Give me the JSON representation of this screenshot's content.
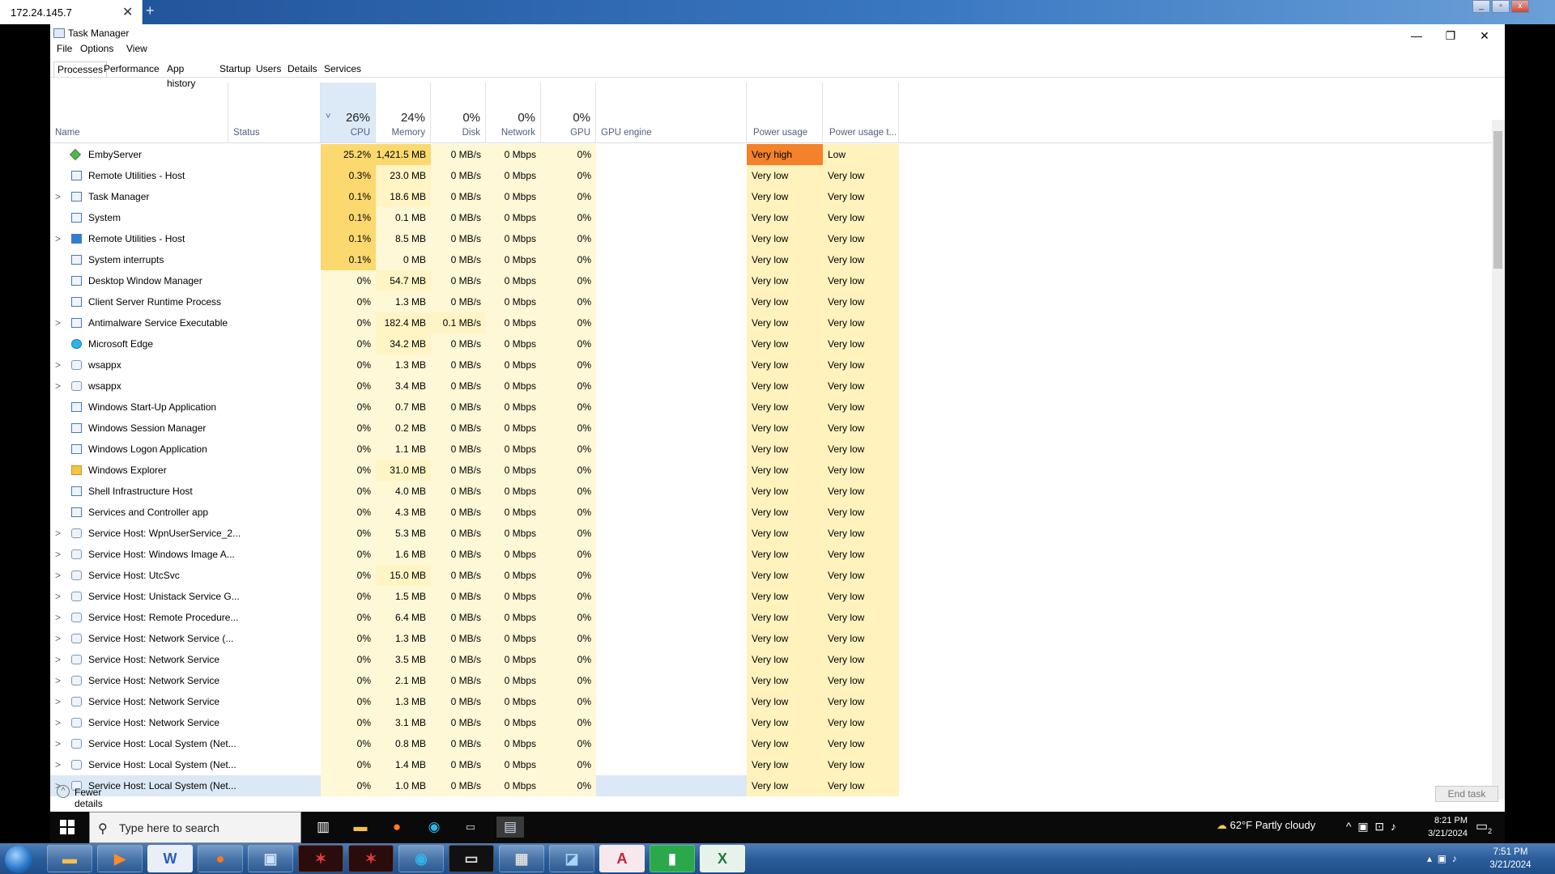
{
  "remote_tab": {
    "title": "172.24.145.7",
    "close": "✕",
    "new": "+"
  },
  "window": {
    "title": "Task Manager",
    "minimize": "—",
    "restore": "❐",
    "close": "✕"
  },
  "menu": [
    "File",
    "Options",
    "View"
  ],
  "tabs": [
    "Processes",
    "Performance",
    "App history",
    "Startup",
    "Users",
    "Details",
    "Services"
  ],
  "active_tab": "Processes",
  "columns": {
    "name": "Name",
    "status": "Status",
    "cpu_pct": "26%",
    "cpu": "CPU",
    "mem_pct": "24%",
    "memory": "Memory",
    "disk_pct": "0%",
    "disk": "Disk",
    "net_pct": "0%",
    "network": "Network",
    "gpu_pct": "0%",
    "gpu": "GPU",
    "gpu_engine": "GPU engine",
    "power": "Power usage",
    "power_trend": "Power usage t...",
    "sort_indicator": "˅"
  },
  "processes": [
    {
      "expand": "",
      "name": "EmbyServer",
      "cpu": "25.2%",
      "mem": "1,421.5 MB",
      "disk": "0 MB/s",
      "net": "0 Mbps",
      "gpu": "0%",
      "power": "Very high",
      "trend": "Low",
      "icon": "emby-icon"
    },
    {
      "expand": "",
      "name": "Remote Utilities - Host",
      "cpu": "0.3%",
      "mem": "23.0 MB",
      "disk": "0 MB/s",
      "net": "0 Mbps",
      "gpu": "0%",
      "power": "Very low",
      "trend": "Very low",
      "icon": "app-icon"
    },
    {
      "expand": ">",
      "name": "Task Manager",
      "cpu": "0.1%",
      "mem": "18.6 MB",
      "disk": "0 MB/s",
      "net": "0 Mbps",
      "gpu": "0%",
      "power": "Very low",
      "trend": "Very low",
      "icon": "task-manager-icon"
    },
    {
      "expand": "",
      "name": "System",
      "cpu": "0.1%",
      "mem": "0.1 MB",
      "disk": "0 MB/s",
      "net": "0 Mbps",
      "gpu": "0%",
      "power": "Very low",
      "trend": "Very low",
      "icon": "app-icon"
    },
    {
      "expand": ">",
      "name": "Remote Utilities - Host",
      "cpu": "0.1%",
      "mem": "8.5 MB",
      "disk": "0 MB/s",
      "net": "0 Mbps",
      "gpu": "0%",
      "power": "Very low",
      "trend": "Very low",
      "icon": "remote-utilities-icon"
    },
    {
      "expand": "",
      "name": "System interrupts",
      "cpu": "0.1%",
      "mem": "0 MB",
      "disk": "0 MB/s",
      "net": "0 Mbps",
      "gpu": "0%",
      "power": "Very low",
      "trend": "Very low",
      "icon": "app-icon"
    },
    {
      "expand": "",
      "name": "Desktop Window Manager",
      "cpu": "0%",
      "mem": "54.7 MB",
      "disk": "0 MB/s",
      "net": "0 Mbps",
      "gpu": "0%",
      "power": "Very low",
      "trend": "Very low",
      "icon": "app-icon"
    },
    {
      "expand": "",
      "name": "Client Server Runtime Process",
      "cpu": "0%",
      "mem": "1.3 MB",
      "disk": "0 MB/s",
      "net": "0 Mbps",
      "gpu": "0%",
      "power": "Very low",
      "trend": "Very low",
      "icon": "app-icon"
    },
    {
      "expand": ">",
      "name": "Antimalware Service Executable",
      "cpu": "0%",
      "mem": "182.4 MB",
      "disk": "0.1 MB/s",
      "net": "0 Mbps",
      "gpu": "0%",
      "power": "Very low",
      "trend": "Very low",
      "icon": "app-icon"
    },
    {
      "expand": "",
      "name": "Microsoft Edge",
      "cpu": "0%",
      "mem": "34.2 MB",
      "disk": "0 MB/s",
      "net": "0 Mbps",
      "gpu": "0%",
      "power": "Very low",
      "trend": "Very low",
      "icon": "edge-icon"
    },
    {
      "expand": ">",
      "name": "wsappx",
      "cpu": "0%",
      "mem": "1.3 MB",
      "disk": "0 MB/s",
      "net": "0 Mbps",
      "gpu": "0%",
      "power": "Very low",
      "trend": "Very low",
      "icon": "gear-icon"
    },
    {
      "expand": ">",
      "name": "wsappx",
      "cpu": "0%",
      "mem": "3.4 MB",
      "disk": "0 MB/s",
      "net": "0 Mbps",
      "gpu": "0%",
      "power": "Very low",
      "trend": "Very low",
      "icon": "gear-icon"
    },
    {
      "expand": "",
      "name": "Windows Start-Up Application",
      "cpu": "0%",
      "mem": "0.7 MB",
      "disk": "0 MB/s",
      "net": "0 Mbps",
      "gpu": "0%",
      "power": "Very low",
      "trend": "Very low",
      "icon": "app-icon"
    },
    {
      "expand": "",
      "name": "Windows Session Manager",
      "cpu": "0%",
      "mem": "0.2 MB",
      "disk": "0 MB/s",
      "net": "0 Mbps",
      "gpu": "0%",
      "power": "Very low",
      "trend": "Very low",
      "icon": "app-icon"
    },
    {
      "expand": "",
      "name": "Windows Logon Application",
      "cpu": "0%",
      "mem": "1.1 MB",
      "disk": "0 MB/s",
      "net": "0 Mbps",
      "gpu": "0%",
      "power": "Very low",
      "trend": "Very low",
      "icon": "app-icon"
    },
    {
      "expand": "",
      "name": "Windows Explorer",
      "cpu": "0%",
      "mem": "31.0 MB",
      "disk": "0 MB/s",
      "net": "0 Mbps",
      "gpu": "0%",
      "power": "Very low",
      "trend": "Very low",
      "icon": "folder-icon"
    },
    {
      "expand": "",
      "name": "Shell Infrastructure Host",
      "cpu": "0%",
      "mem": "4.0 MB",
      "disk": "0 MB/s",
      "net": "0 Mbps",
      "gpu": "0%",
      "power": "Very low",
      "trend": "Very low",
      "icon": "app-icon"
    },
    {
      "expand": "",
      "name": "Services and Controller app",
      "cpu": "0%",
      "mem": "4.3 MB",
      "disk": "0 MB/s",
      "net": "0 Mbps",
      "gpu": "0%",
      "power": "Very low",
      "trend": "Very low",
      "icon": "app-icon"
    },
    {
      "expand": ">",
      "name": "Service Host: WpnUserService_2...",
      "cpu": "0%",
      "mem": "5.3 MB",
      "disk": "0 MB/s",
      "net": "0 Mbps",
      "gpu": "0%",
      "power": "Very low",
      "trend": "Very low",
      "icon": "gear-icon"
    },
    {
      "expand": ">",
      "name": "Service Host: Windows Image A...",
      "cpu": "0%",
      "mem": "1.6 MB",
      "disk": "0 MB/s",
      "net": "0 Mbps",
      "gpu": "0%",
      "power": "Very low",
      "trend": "Very low",
      "icon": "gear-icon"
    },
    {
      "expand": ">",
      "name": "Service Host: UtcSvc",
      "cpu": "0%",
      "mem": "15.0 MB",
      "disk": "0 MB/s",
      "net": "0 Mbps",
      "gpu": "0%",
      "power": "Very low",
      "trend": "Very low",
      "icon": "gear-icon"
    },
    {
      "expand": ">",
      "name": "Service Host: Unistack Service G...",
      "cpu": "0%",
      "mem": "1.5 MB",
      "disk": "0 MB/s",
      "net": "0 Mbps",
      "gpu": "0%",
      "power": "Very low",
      "trend": "Very low",
      "icon": "gear-icon"
    },
    {
      "expand": ">",
      "name": "Service Host: Remote Procedure...",
      "cpu": "0%",
      "mem": "6.4 MB",
      "disk": "0 MB/s",
      "net": "0 Mbps",
      "gpu": "0%",
      "power": "Very low",
      "trend": "Very low",
      "icon": "gear-icon"
    },
    {
      "expand": ">",
      "name": "Service Host: Network Service (...",
      "cpu": "0%",
      "mem": "1.3 MB",
      "disk": "0 MB/s",
      "net": "0 Mbps",
      "gpu": "0%",
      "power": "Very low",
      "trend": "Very low",
      "icon": "gear-icon"
    },
    {
      "expand": ">",
      "name": "Service Host: Network Service",
      "cpu": "0%",
      "mem": "3.5 MB",
      "disk": "0 MB/s",
      "net": "0 Mbps",
      "gpu": "0%",
      "power": "Very low",
      "trend": "Very low",
      "icon": "gear-icon"
    },
    {
      "expand": ">",
      "name": "Service Host: Network Service",
      "cpu": "0%",
      "mem": "2.1 MB",
      "disk": "0 MB/s",
      "net": "0 Mbps",
      "gpu": "0%",
      "power": "Very low",
      "trend": "Very low",
      "icon": "gear-icon"
    },
    {
      "expand": ">",
      "name": "Service Host: Network Service",
      "cpu": "0%",
      "mem": "1.3 MB",
      "disk": "0 MB/s",
      "net": "0 Mbps",
      "gpu": "0%",
      "power": "Very low",
      "trend": "Very low",
      "icon": "gear-icon"
    },
    {
      "expand": ">",
      "name": "Service Host: Network Service",
      "cpu": "0%",
      "mem": "3.1 MB",
      "disk": "0 MB/s",
      "net": "0 Mbps",
      "gpu": "0%",
      "power": "Very low",
      "trend": "Very low",
      "icon": "gear-icon"
    },
    {
      "expand": ">",
      "name": "Service Host: Local System (Net...",
      "cpu": "0%",
      "mem": "0.8 MB",
      "disk": "0 MB/s",
      "net": "0 Mbps",
      "gpu": "0%",
      "power": "Very low",
      "trend": "Very low",
      "icon": "gear-icon"
    },
    {
      "expand": ">",
      "name": "Service Host: Local System (Net...",
      "cpu": "0%",
      "mem": "1.4 MB",
      "disk": "0 MB/s",
      "net": "0 Mbps",
      "gpu": "0%",
      "power": "Very low",
      "trend": "Very low",
      "icon": "gear-icon"
    },
    {
      "expand": ">",
      "name": "Service Host: Local System (Net...",
      "cpu": "0%",
      "mem": "1.0 MB",
      "disk": "0 MB/s",
      "net": "0 Mbps",
      "gpu": "0%",
      "power": "Very low",
      "trend": "Very low",
      "icon": "gear-icon",
      "selected": true
    }
  ],
  "footer": {
    "fewer_details": "Fewer details",
    "end_task": "End task"
  },
  "remote_taskbar": {
    "search_placeholder": "Type here to search",
    "weather": "62°F  Partly cloudy",
    "time": "8:21 PM",
    "date": "3/21/2024",
    "notifications": "2"
  },
  "local_taskbar": {
    "time": "7:51 PM",
    "date": "3/21/2024"
  },
  "colors": {
    "cpu_heat_high": "#fbd96f",
    "cpu_heat_low": "#fff4c4",
    "heat_base": "#fff8d6",
    "power_very_high": "#f4822a",
    "power_low": "#fff2bd",
    "selection": "#dbe8f6"
  }
}
